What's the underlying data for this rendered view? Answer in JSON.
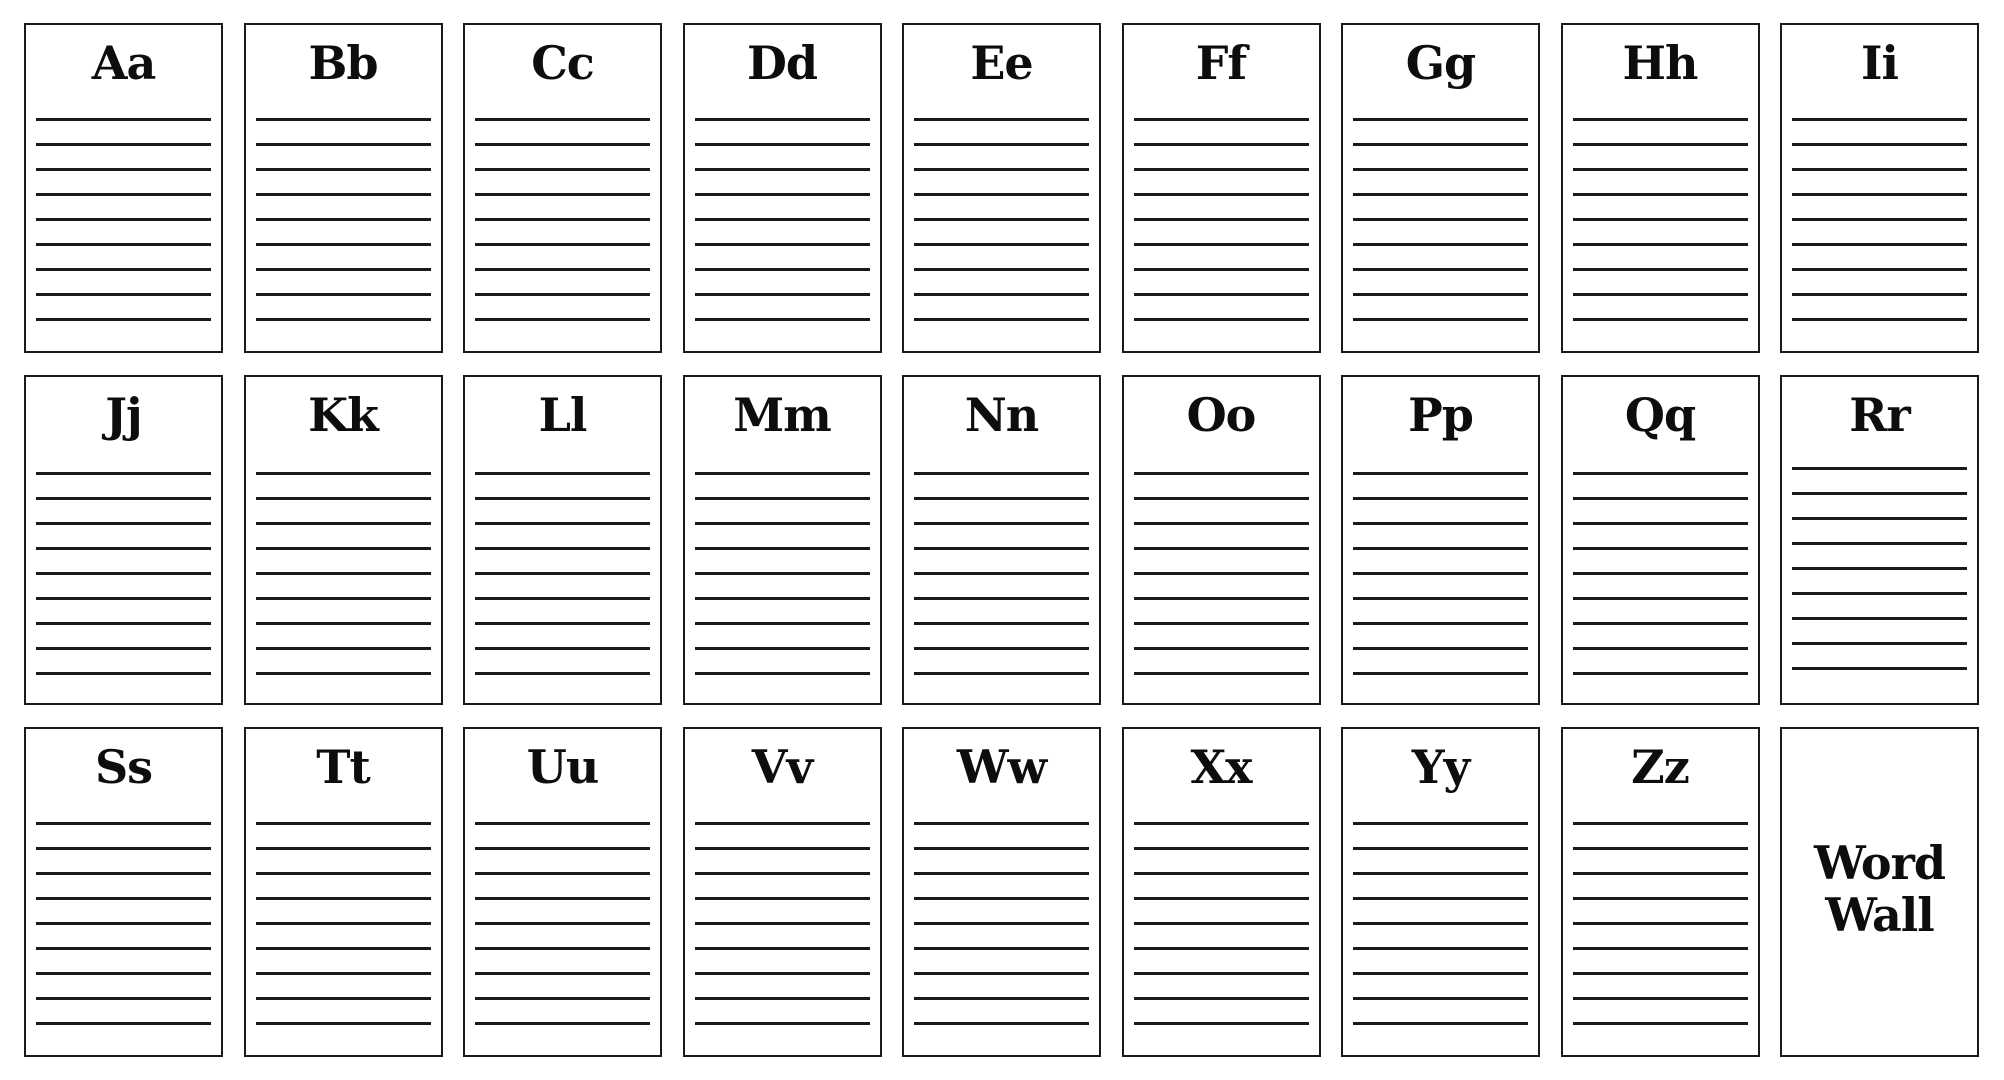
{
  "document": {
    "title": "Word Wall"
  },
  "layout_grid": {
    "columns": 9,
    "rows": 3,
    "lines_per_card": 9
  },
  "cards": [
    {
      "label": "Aa"
    },
    {
      "label": "Bb"
    },
    {
      "label": "Cc"
    },
    {
      "label": "Dd"
    },
    {
      "label": "Ee"
    },
    {
      "label": "Ff"
    },
    {
      "label": "Gg"
    },
    {
      "label": "Hh"
    },
    {
      "label": "Ii"
    },
    {
      "label": "Jj"
    },
    {
      "label": "Kk"
    },
    {
      "label": "Ll"
    },
    {
      "label": "Mm"
    },
    {
      "label": "Nn"
    },
    {
      "label": "Oo"
    },
    {
      "label": "Pp"
    },
    {
      "label": "Qq"
    },
    {
      "label": "Rr"
    },
    {
      "label": "Ss"
    },
    {
      "label": "Tt"
    },
    {
      "label": "Uu"
    },
    {
      "label": "Vv"
    },
    {
      "label": "Ww"
    },
    {
      "label": "Xx"
    },
    {
      "label": "Yy"
    },
    {
      "label": "Zz"
    }
  ],
  "title_card": {
    "line1": "Word",
    "line2": "Wall"
  },
  "colors": {
    "ink": "#1a1a1a",
    "paper": "#ffffff"
  }
}
